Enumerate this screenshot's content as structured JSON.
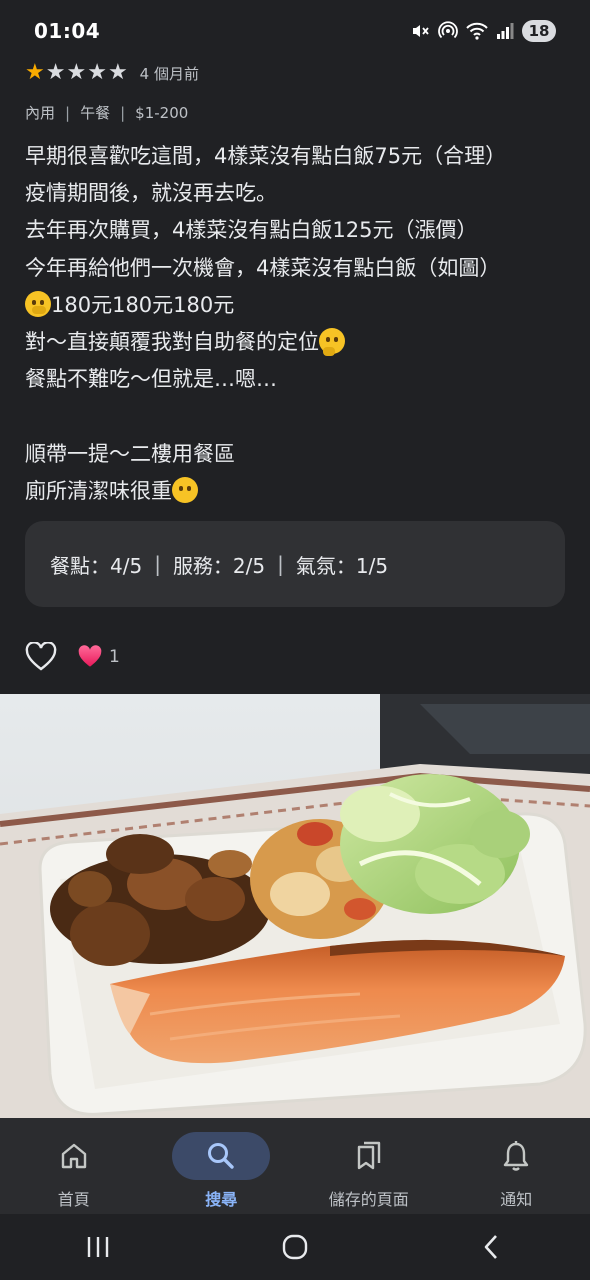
{
  "status_bar": {
    "time": "01:04",
    "battery": "18"
  },
  "review": {
    "rating": 1,
    "max_rating": 5,
    "age": "4 個月前",
    "meta": {
      "dine": "內用",
      "meal": "午餐",
      "price": "$1-200"
    },
    "lines": [
      "早期很喜歡吃這間，4樣菜沒有點白飯75元（合理）",
      "疫情期間後，就沒再去吃。",
      "去年再次購買，4樣菜沒有點白飯125元（漲價）",
      "今年再給他們一次機會，4樣菜沒有點白飯（如圖）",
      "180元180元180元",
      "對～直接顛覆我對自助餐的定位",
      "餐點不難吃～但就是…嗯…",
      "",
      "順帶一提～二樓用餐區",
      "廁所清潔味很重"
    ],
    "emojis": {
      "line5": "face-with-open-eyes-and-hand-over-mouth-icon",
      "line6": "thinking-face-icon",
      "line10": "face-without-mouth-icon"
    }
  },
  "subratings": {
    "food": "餐點：4/5",
    "service": "服務：2/5",
    "atmosphere": "氣氛：1/5"
  },
  "reactions": {
    "like_icon": "heart-outline-icon",
    "heart_count": "1"
  },
  "bottom_nav": {
    "items": [
      {
        "label": "首頁",
        "icon": "home-icon",
        "active": false
      },
      {
        "label": "搜尋",
        "icon": "search-icon",
        "active": true
      },
      {
        "label": "儲存的頁面",
        "icon": "saved-pages-icon",
        "active": false
      },
      {
        "label": "通知",
        "icon": "bell-icon",
        "active": false
      }
    ]
  },
  "colors": {
    "background": "#202124",
    "star": "#f9ab00",
    "active_nav": "#8ab4f8",
    "active_pill": "#3c4a68"
  }
}
